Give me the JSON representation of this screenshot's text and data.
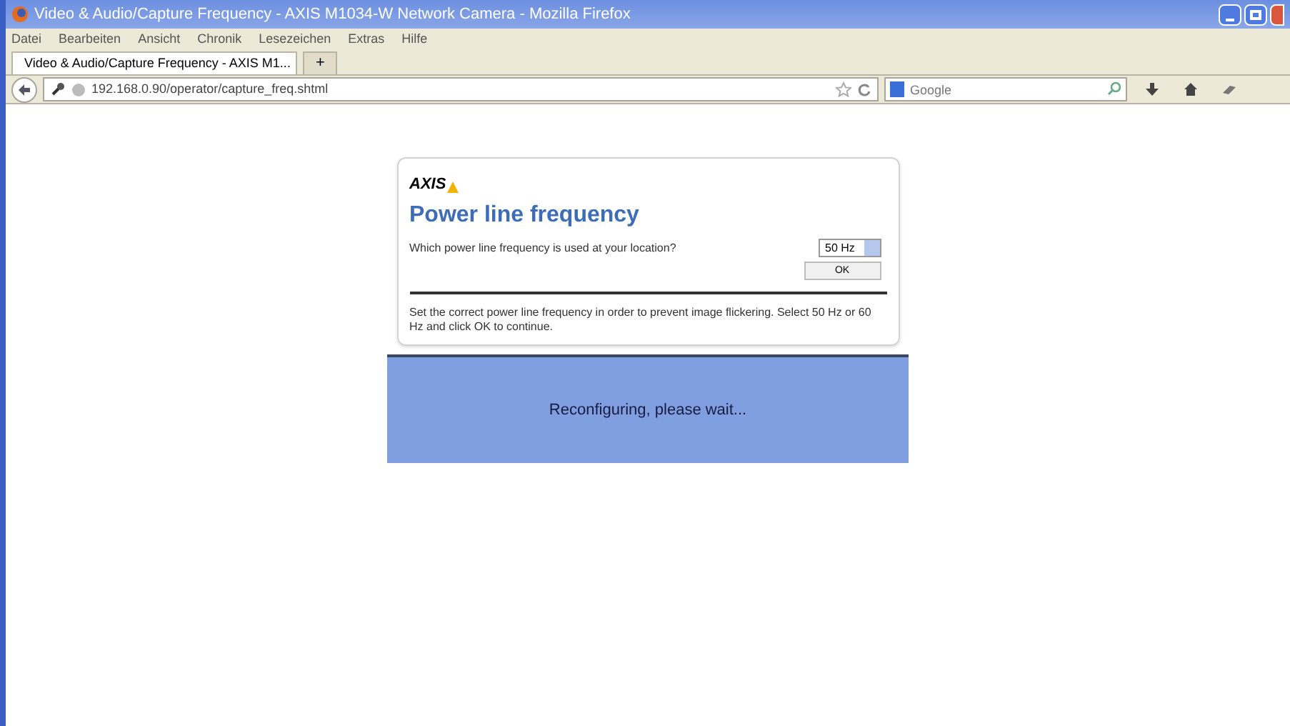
{
  "window": {
    "title": "Video & Audio/Capture Frequency - AXIS M1034-W Network Camera - Mozilla Firefox"
  },
  "menu": [
    "Datei",
    "Bearbeiten",
    "Ansicht",
    "Chronik",
    "Lesezeichen",
    "Extras",
    "Hilfe"
  ],
  "tabs": [
    {
      "label": "Video & Audio/Capture Frequency - AXIS M1...",
      "selected": true
    }
  ],
  "new_tab": "+",
  "address_bar": {
    "value": "192.168.0.90/operator/capture_freq.shtml"
  },
  "search": {
    "placeholder": "Google"
  },
  "dialog": {
    "logo": "AXIS",
    "title": "Power line frequency",
    "question": "Which power line frequency is used at your location?",
    "frequency": "50 Hz",
    "ok": "OK",
    "description": "Set the correct power line frequency in order to prevent image flickering. Select 50 Hz or 60 Hz and click OK to continue."
  },
  "overlay": {
    "message": "Reconfiguring, please wait..."
  }
}
